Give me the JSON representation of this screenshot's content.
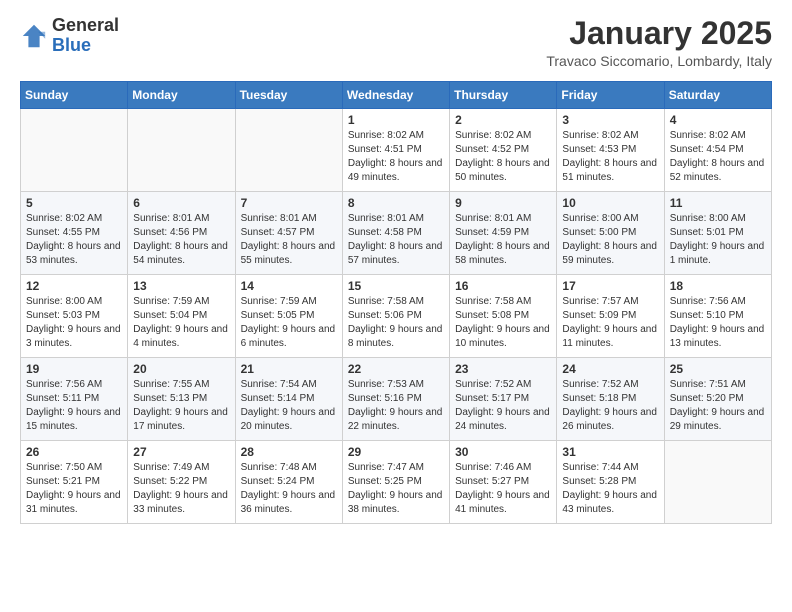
{
  "header": {
    "logo_general": "General",
    "logo_blue": "Blue",
    "month_title": "January 2025",
    "location": "Travaco Siccomario, Lombardy, Italy"
  },
  "days_of_week": [
    "Sunday",
    "Monday",
    "Tuesday",
    "Wednesday",
    "Thursday",
    "Friday",
    "Saturday"
  ],
  "weeks": [
    [
      {
        "day": "",
        "info": ""
      },
      {
        "day": "",
        "info": ""
      },
      {
        "day": "",
        "info": ""
      },
      {
        "day": "1",
        "info": "Sunrise: 8:02 AM\nSunset: 4:51 PM\nDaylight: 8 hours and 49 minutes."
      },
      {
        "day": "2",
        "info": "Sunrise: 8:02 AM\nSunset: 4:52 PM\nDaylight: 8 hours and 50 minutes."
      },
      {
        "day": "3",
        "info": "Sunrise: 8:02 AM\nSunset: 4:53 PM\nDaylight: 8 hours and 51 minutes."
      },
      {
        "day": "4",
        "info": "Sunrise: 8:02 AM\nSunset: 4:54 PM\nDaylight: 8 hours and 52 minutes."
      }
    ],
    [
      {
        "day": "5",
        "info": "Sunrise: 8:02 AM\nSunset: 4:55 PM\nDaylight: 8 hours and 53 minutes."
      },
      {
        "day": "6",
        "info": "Sunrise: 8:01 AM\nSunset: 4:56 PM\nDaylight: 8 hours and 54 minutes."
      },
      {
        "day": "7",
        "info": "Sunrise: 8:01 AM\nSunset: 4:57 PM\nDaylight: 8 hours and 55 minutes."
      },
      {
        "day": "8",
        "info": "Sunrise: 8:01 AM\nSunset: 4:58 PM\nDaylight: 8 hours and 57 minutes."
      },
      {
        "day": "9",
        "info": "Sunrise: 8:01 AM\nSunset: 4:59 PM\nDaylight: 8 hours and 58 minutes."
      },
      {
        "day": "10",
        "info": "Sunrise: 8:00 AM\nSunset: 5:00 PM\nDaylight: 8 hours and 59 minutes."
      },
      {
        "day": "11",
        "info": "Sunrise: 8:00 AM\nSunset: 5:01 PM\nDaylight: 9 hours and 1 minute."
      }
    ],
    [
      {
        "day": "12",
        "info": "Sunrise: 8:00 AM\nSunset: 5:03 PM\nDaylight: 9 hours and 3 minutes."
      },
      {
        "day": "13",
        "info": "Sunrise: 7:59 AM\nSunset: 5:04 PM\nDaylight: 9 hours and 4 minutes."
      },
      {
        "day": "14",
        "info": "Sunrise: 7:59 AM\nSunset: 5:05 PM\nDaylight: 9 hours and 6 minutes."
      },
      {
        "day": "15",
        "info": "Sunrise: 7:58 AM\nSunset: 5:06 PM\nDaylight: 9 hours and 8 minutes."
      },
      {
        "day": "16",
        "info": "Sunrise: 7:58 AM\nSunset: 5:08 PM\nDaylight: 9 hours and 10 minutes."
      },
      {
        "day": "17",
        "info": "Sunrise: 7:57 AM\nSunset: 5:09 PM\nDaylight: 9 hours and 11 minutes."
      },
      {
        "day": "18",
        "info": "Sunrise: 7:56 AM\nSunset: 5:10 PM\nDaylight: 9 hours and 13 minutes."
      }
    ],
    [
      {
        "day": "19",
        "info": "Sunrise: 7:56 AM\nSunset: 5:11 PM\nDaylight: 9 hours and 15 minutes."
      },
      {
        "day": "20",
        "info": "Sunrise: 7:55 AM\nSunset: 5:13 PM\nDaylight: 9 hours and 17 minutes."
      },
      {
        "day": "21",
        "info": "Sunrise: 7:54 AM\nSunset: 5:14 PM\nDaylight: 9 hours and 20 minutes."
      },
      {
        "day": "22",
        "info": "Sunrise: 7:53 AM\nSunset: 5:16 PM\nDaylight: 9 hours and 22 minutes."
      },
      {
        "day": "23",
        "info": "Sunrise: 7:52 AM\nSunset: 5:17 PM\nDaylight: 9 hours and 24 minutes."
      },
      {
        "day": "24",
        "info": "Sunrise: 7:52 AM\nSunset: 5:18 PM\nDaylight: 9 hours and 26 minutes."
      },
      {
        "day": "25",
        "info": "Sunrise: 7:51 AM\nSunset: 5:20 PM\nDaylight: 9 hours and 29 minutes."
      }
    ],
    [
      {
        "day": "26",
        "info": "Sunrise: 7:50 AM\nSunset: 5:21 PM\nDaylight: 9 hours and 31 minutes."
      },
      {
        "day": "27",
        "info": "Sunrise: 7:49 AM\nSunset: 5:22 PM\nDaylight: 9 hours and 33 minutes."
      },
      {
        "day": "28",
        "info": "Sunrise: 7:48 AM\nSunset: 5:24 PM\nDaylight: 9 hours and 36 minutes."
      },
      {
        "day": "29",
        "info": "Sunrise: 7:47 AM\nSunset: 5:25 PM\nDaylight: 9 hours and 38 minutes."
      },
      {
        "day": "30",
        "info": "Sunrise: 7:46 AM\nSunset: 5:27 PM\nDaylight: 9 hours and 41 minutes."
      },
      {
        "day": "31",
        "info": "Sunrise: 7:44 AM\nSunset: 5:28 PM\nDaylight: 9 hours and 43 minutes."
      },
      {
        "day": "",
        "info": ""
      }
    ]
  ]
}
